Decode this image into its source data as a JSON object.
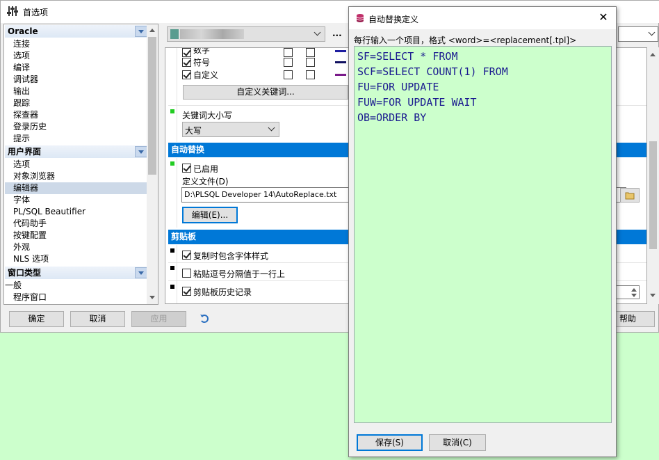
{
  "prefs": {
    "title": "首选项",
    "tree": {
      "groups": [
        {
          "label": "Oracle",
          "items": [
            "连接",
            "选项",
            "编译",
            "调试器",
            "输出",
            "跟踪",
            "探查器",
            "登录历史",
            "提示"
          ]
        },
        {
          "label": "用户界面",
          "items": [
            "选项",
            "对象浏览器",
            "编辑器",
            "字体",
            "PL/SQL Beautifier",
            "代码助手",
            "按键配置",
            "外观",
            "NLS 选项"
          ]
        },
        {
          "label": "窗口类型",
          "items": [
            "一般",
            "程序窗口"
          ]
        }
      ],
      "selected": "编辑器"
    },
    "toolbar": {
      "more_label": "..."
    },
    "keywords": {
      "rows": [
        "数字",
        "符号",
        "自定义"
      ],
      "custom_button": "自定义关键词...",
      "case_label": "关键词大小写",
      "case_value": "大写"
    },
    "autoreplace": {
      "section": "自动替换",
      "enabled_label": "已启用",
      "file_label": "定义文件(D)",
      "file_value": "D:\\PLSQL Developer 14\\AutoReplace.txt",
      "edit_button": "编辑(E)..."
    },
    "clipboard": {
      "section": "剪贴板",
      "opt1": "复制时包含字体样式",
      "opt2": "粘贴逗号分隔值于一行上",
      "opt3": "剪贴板历史记录"
    },
    "buttons": {
      "ok": "确定",
      "cancel": "取消",
      "apply": "应用",
      "help": "帮助"
    }
  },
  "dialog": {
    "title": "自动替换定义",
    "hint": "每行输入一个项目，格式 <word>=<replacement[.tpl]>",
    "lines": [
      "SF=SELECT * FROM",
      "SCF=SELECT COUNT(1) FROM",
      "FU=FOR UPDATE",
      "FUW=FOR UPDATE WAIT",
      "OB=ORDER BY"
    ],
    "save": "保存(S)",
    "cancel": "取消(C)"
  },
  "colors": {
    "accent": "#0078d7",
    "editor_bg": "#ccffcc",
    "editor_text": "#1a1a8f",
    "desktop": "#ccffcc"
  }
}
